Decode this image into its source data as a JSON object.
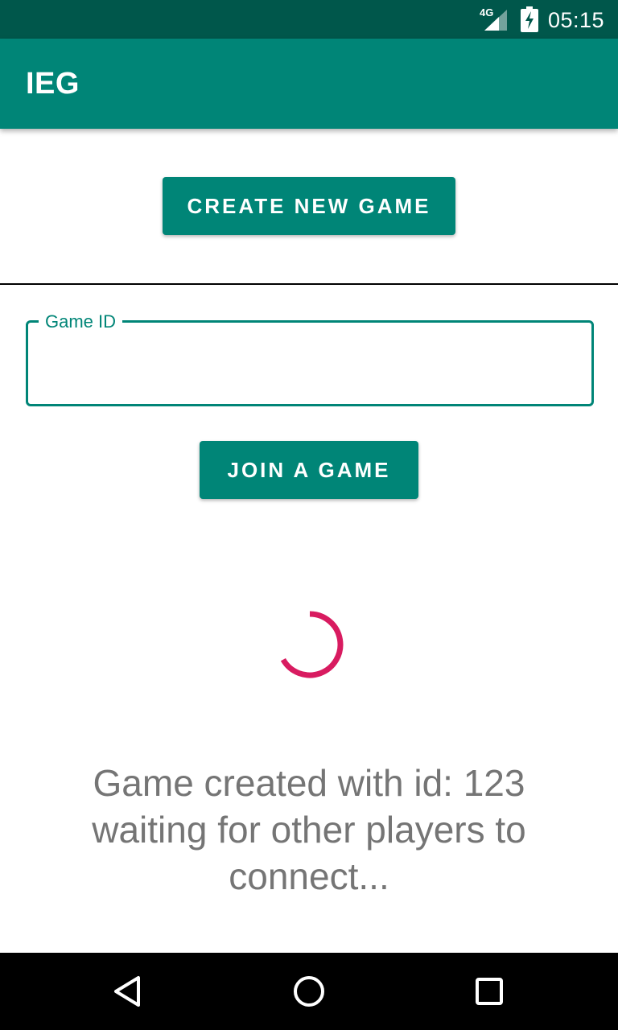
{
  "status_bar": {
    "network": "4G",
    "time": "05:15"
  },
  "app_bar": {
    "title": "IEG"
  },
  "create_button": {
    "label": "CREATE NEW GAME"
  },
  "game_id_field": {
    "label": "Game ID",
    "value": ""
  },
  "join_button": {
    "label": "JOIN A GAME"
  },
  "progress": {
    "color": "#D81B60"
  },
  "message": {
    "text": "Game created with id: 123 waiting for other players to connect..."
  },
  "colors": {
    "primary": "#008577",
    "primary_dark": "#00574B",
    "accent": "#D81B60"
  },
  "nav_bar": {
    "icons": [
      "back-icon",
      "home-icon",
      "recents-icon"
    ]
  }
}
